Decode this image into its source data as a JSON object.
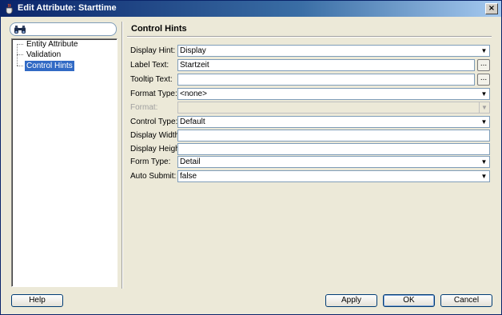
{
  "window": {
    "title": "Edit Attribute: Starttime",
    "close_label": "×"
  },
  "sidebar": {
    "search_placeholder": "",
    "items": [
      {
        "label": "Entity Attribute",
        "selected": false
      },
      {
        "label": "Validation",
        "selected": false
      },
      {
        "label": "Control Hints",
        "selected": true
      }
    ]
  },
  "main": {
    "section_title": "Control Hints",
    "fields": {
      "display_hint": {
        "label": "Display Hint:",
        "value": "Display"
      },
      "label_text": {
        "label": "Label Text:",
        "value": "Startzeit"
      },
      "tooltip_text": {
        "label": "Tooltip Text:",
        "value": ""
      },
      "format_type": {
        "label": "Format Type:",
        "value": "<none>"
      },
      "format": {
        "label": "Format:",
        "value": ""
      },
      "control_type": {
        "label": "Control Type:",
        "value": "Default"
      },
      "display_width": {
        "label": "Display Width:",
        "value": ""
      },
      "display_height": {
        "label": "Display Height:",
        "value": ""
      },
      "form_type": {
        "label": "Form Type:",
        "value": "Detail"
      },
      "auto_submit": {
        "label": "Auto Submit:",
        "value": "false"
      }
    },
    "ellipsis_label": "..."
  },
  "footer": {
    "help_label": "Help",
    "apply_label": "Apply",
    "ok_label": "OK",
    "cancel_label": "Cancel"
  },
  "icons": {
    "app": "java-cup-icon",
    "search": "binoculars-icon",
    "dropdown": "chevron-down-icon"
  },
  "colors": {
    "titlebar": "#0a246a",
    "selection": "#316ac5",
    "window_bg": "#ece9d8"
  }
}
